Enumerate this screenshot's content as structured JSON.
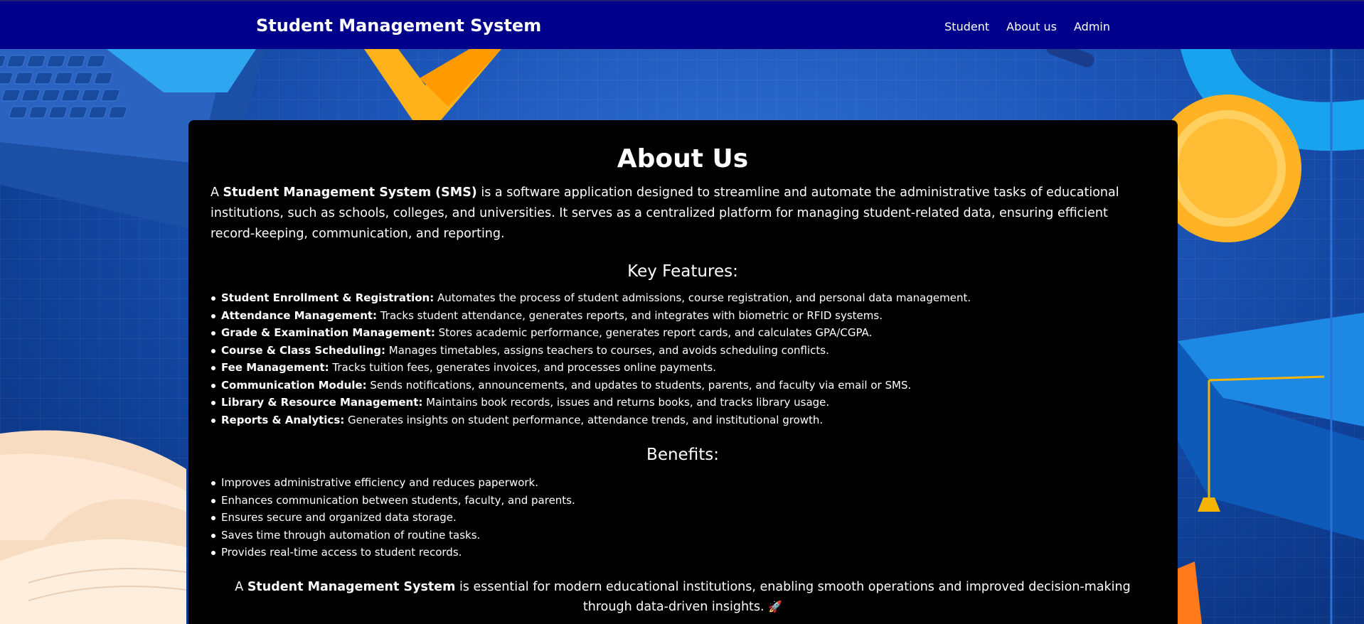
{
  "navbar": {
    "brand": "Student Management System",
    "links": [
      "Student",
      "About us",
      "Admin"
    ]
  },
  "about": {
    "title": "About Us",
    "intro": {
      "prefix": "A ",
      "bold": "Student Management System (SMS)",
      "rest": " is a software application designed to streamline and automate the administrative tasks of educational institutions, such as schools, colleges, and universities. It serves as a centralized platform for managing student-related data, ensuring efficient record-keeping, communication, and reporting."
    },
    "features_heading": "Key Features:",
    "features": [
      {
        "title": "Student Enrollment & Registration:",
        "text": " Automates the process of student admissions, course registration, and personal data management."
      },
      {
        "title": "Attendance Management:",
        "text": " Tracks student attendance, generates reports, and integrates with biometric or RFID systems."
      },
      {
        "title": "Grade & Examination Management:",
        "text": " Stores academic performance, generates report cards, and calculates GPA/CGPA."
      },
      {
        "title": "Course & Class Scheduling:",
        "text": " Manages timetables, assigns teachers to courses, and avoids scheduling conflicts."
      },
      {
        "title": "Fee Management:",
        "text": " Tracks tuition fees, generates invoices, and processes online payments."
      },
      {
        "title": "Communication Module:",
        "text": " Sends notifications, announcements, and updates to students, parents, and faculty via email or SMS."
      },
      {
        "title": "Library & Resource Management:",
        "text": " Maintains book records, issues and returns books, and tracks library usage."
      },
      {
        "title": "Reports & Analytics:",
        "text": " Generates insights on student performance, attendance trends, and institutional growth."
      }
    ],
    "benefits_heading": "Benefits:",
    "benefits": [
      "Improves administrative efficiency and reduces paperwork.",
      "Enhances communication between students, faculty, and parents.",
      "Ensures secure and organized data storage.",
      "Saves time through automation of routine tasks.",
      "Provides real-time access to student records."
    ],
    "closing": {
      "prefix": "A ",
      "bold": "Student Management System",
      "rest": " is essential for modern educational institutions, enabling smooth operations and improved decision-making through data-driven insights. ",
      "emoji": "🚀"
    }
  },
  "colors": {
    "navbar_bg": "#00008b",
    "card_bg": "#000000",
    "text": "#ffffff"
  }
}
